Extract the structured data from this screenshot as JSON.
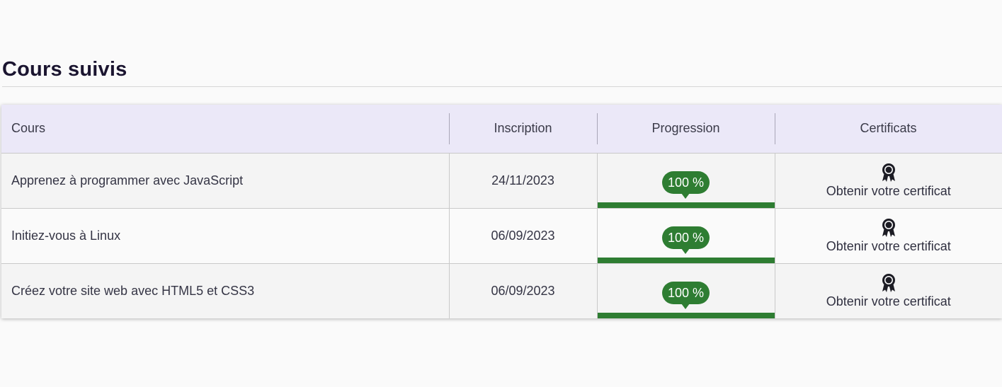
{
  "page": {
    "title": "Cours suivis"
  },
  "table": {
    "headers": {
      "course": "Cours",
      "enrollment": "Inscription",
      "progress": "Progression",
      "certificates": "Certificats"
    },
    "rows": [
      {
        "course": "Apprenez à programmer avec JavaScript",
        "enrollment": "24/11/2023",
        "progress_label": "100 %",
        "progress_value": 1.0,
        "certificate_label": "Obtenir votre certificat",
        "certificate_icon": "award-ribbon-icon"
      },
      {
        "course": "Initiez-vous à Linux",
        "enrollment": "06/09/2023",
        "progress_label": "100 %",
        "progress_value": 1.0,
        "certificate_label": "Obtenir votre certificat",
        "certificate_icon": "award-ribbon-icon"
      },
      {
        "course": "Créez votre site web avec HTML5 et CSS3",
        "enrollment": "06/09/2023",
        "progress_label": "100 %",
        "progress_value": 1.0,
        "certificate_label": "Obtenir votre certificat",
        "certificate_icon": "award-ribbon-icon"
      }
    ]
  },
  "colors": {
    "progress": "#2e7d32",
    "header_bg": "#ebe8f8"
  }
}
